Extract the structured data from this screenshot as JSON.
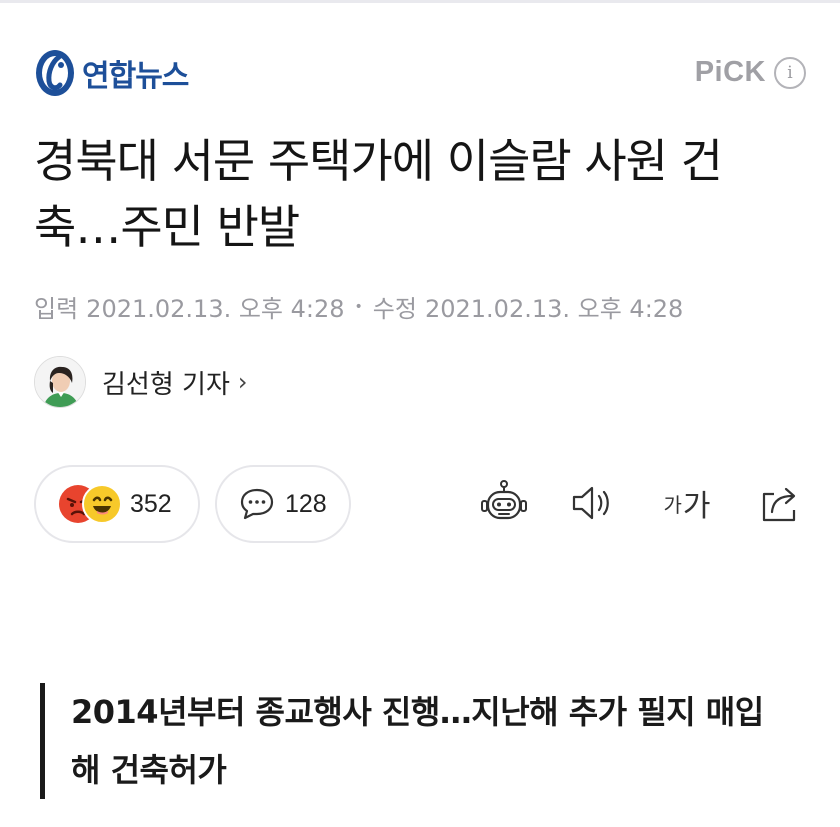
{
  "publisher": {
    "name": "연합뉴스",
    "logo_icon": "yonhap-logo-icon"
  },
  "pick": {
    "label": "PiCK",
    "info_glyph": "i"
  },
  "article": {
    "title": "경북대 서문 주택가에 이슬람 사원 건축…주민 반발",
    "date_input_label": "입력",
    "date_input": "2021.02.13. 오후 4:28",
    "date_separator": "•",
    "date_modified_label": "수정",
    "date_modified": "2021.02.13. 오후 4:28",
    "author": "김선형 기자",
    "author_chevron": "›",
    "subheading": "2014년부터 종교행사 진행…지난해 추가 필지 매입해 건축허가"
  },
  "actions": {
    "reaction_count": "352",
    "comment_count": "128",
    "font_small_glyph": "가",
    "font_large_glyph": "가"
  },
  "colors": {
    "brand_blue": "#1d4f99",
    "muted_gray": "#9a9aa0",
    "angry_red": "#e8442e",
    "smile_yellow": "#f7c92a"
  }
}
